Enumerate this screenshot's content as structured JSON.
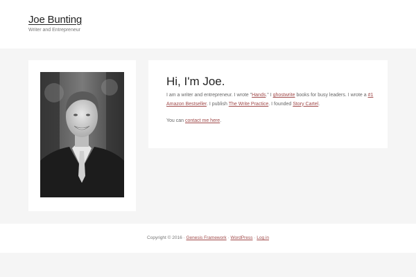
{
  "header": {
    "title": "Joe Bunting",
    "description": "Writer and Entrepreneur"
  },
  "content": {
    "heading": "Hi, I'm Joe.",
    "p1": {
      "t1": "I am a writer and entrepreneur. I wrote \"",
      "link_hands": "Hands",
      "t2": ".\" I ",
      "link_ghostwrite": "ghostwrite",
      "t3": " books for busy leaders. I wrote a ",
      "link_bestseller": "#1 Amazon Bestseller",
      "t4": ". I publish ",
      "link_write_practice": "The Write Practice",
      "t5": ". I founded ",
      "link_story_cartel": "Story Cartel",
      "t6": "."
    },
    "p2": {
      "t1": "You can ",
      "link_contact": "contact me here",
      "t2": "."
    }
  },
  "footer": {
    "copyright": "Copyright © 2016 · ",
    "link_genesis": "Genesis Framework",
    "sep1": " · ",
    "link_wordpress": "WordPress",
    "sep2": " · ",
    "link_login": "Log in"
  }
}
